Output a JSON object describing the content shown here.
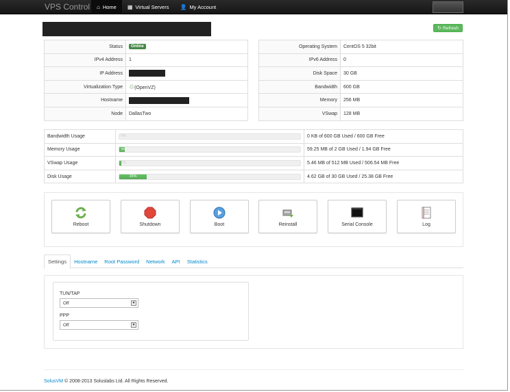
{
  "navbar": {
    "brand": "VPS Control",
    "items": [
      {
        "label": "Home",
        "icon": "home-icon"
      },
      {
        "label": "Virtual Servers",
        "icon": "grid-icon"
      },
      {
        "label": "My Account",
        "icon": "user-icon"
      }
    ]
  },
  "refresh_label": "Refresh",
  "left_info": {
    "status_label": "Status",
    "status_value": "Online",
    "ipv4_label": "IPv4 Address",
    "ipv4_value": "1",
    "ip_label": "IP Address",
    "virt_label": "Virtualization Type",
    "virt_value": "(OpenVZ)",
    "hostname_label": "Hostname",
    "node_label": "Node",
    "node_value": "DallasTwo"
  },
  "right_info": {
    "os_label": "Operating System",
    "os_value": "CentOS 5 32bit",
    "ipv6_label": "IPv6 Address",
    "ipv6_value": "0",
    "disk_label": "Disk Space",
    "disk_value": "30 GB",
    "bw_label": "Bandwidth",
    "bw_value": "600 GB",
    "mem_label": "Memory",
    "mem_value": "256 MB",
    "vswap_label": "VSwap",
    "vswap_value": "128 MB"
  },
  "usage": [
    {
      "label": "Bandwidth Usage",
      "percent": 0,
      "bar_text": "0%",
      "text": "0 KB of 600 GB Used / 600 GB Free"
    },
    {
      "label": "Memory Usage",
      "percent": 3,
      "bar_text": "3%",
      "text": "59.25 MB of 2 GB Used / 1.94 GB Free"
    },
    {
      "label": "VSwap Usage",
      "percent": 1,
      "bar_text": "1%",
      "text": "5.46 MB of 512 MB Used / 506.54 MB Free"
    },
    {
      "label": "Disk Usage",
      "percent": 15,
      "bar_text": "15%",
      "text": "4.62 GB of 30 GB Used / 25.38 GB Free"
    }
  ],
  "actions": [
    {
      "label": "Reboot",
      "icon": "reboot-icon"
    },
    {
      "label": "Shutdown",
      "icon": "shutdown-icon"
    },
    {
      "label": "Boot",
      "icon": "boot-icon"
    },
    {
      "label": "Reinstall",
      "icon": "reinstall-icon"
    },
    {
      "label": "Serial Console",
      "icon": "console-icon"
    },
    {
      "label": "Log",
      "icon": "log-icon"
    }
  ],
  "tabs": [
    "Settings",
    "Hostname",
    "Root Password",
    "Network",
    "API",
    "Statistics"
  ],
  "settings": {
    "tuntap_label": "TUN/TAP",
    "tuntap_value": "Off",
    "ppp_label": "PPP",
    "ppp_value": "Off"
  },
  "footer": {
    "link": "SolusVM",
    "text": " © 2008-2013 Soluslabs Ltd. All Rights Reserved."
  }
}
